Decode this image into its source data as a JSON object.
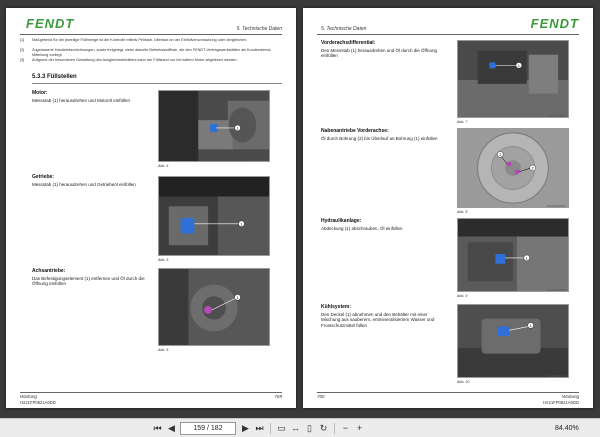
{
  "brand": "FENDT",
  "left_page": {
    "chapter": "5. Technische Daten",
    "footnotes": [
      {
        "num": "[1]",
        "text": "Maßgebend für die jeweilige Füllmenge ist die Kontrolle mittels Peilstab, Überlauf an der Einfüllverschraubung oder dergleichen."
      },
      {
        "num": "[2]",
        "text": "Zugelassene Handelsbezeichnungen, sowie freigelegt, siehe aktuelle Betriebsstoffliste, die den FENDT-Vertragswerkstätten als Kundendienst-Mitteilung vorliegt."
      },
      {
        "num": "[3]",
        "text": "Aufgrund der besonderen Gestaltung des Ausgleichsbehälters kann der Füllstand nur bei kaltem Motor abgelesen werden."
      }
    ],
    "section_title": "5.3.3  Füllstellen",
    "items": [
      {
        "label": "Motor:",
        "text": "Messstab (1) herausdrehen und Motoröl einfüllen",
        "caption": "Abb. 4",
        "code": "FSL0001234567"
      },
      {
        "label": "Getriebe:",
        "text": "Messstab (1) herausdrehen und Getriebeöl einfüllen",
        "caption": "Abb. 5",
        "code": "FSL0001234568"
      },
      {
        "label": "Achsantriebe:",
        "text": "Das Befestigungselement (1) entfernen und Öl durch die Öffnung einfüllen",
        "caption": "Abb. 6",
        "code": "FSL0001234569"
      }
    ],
    "footer_title": "Wartung",
    "footer_code": "H221FP0621A0DD",
    "page_number": "769"
  },
  "right_page": {
    "chapter": "5. Technische Daten",
    "items": [
      {
        "label": "Vorderachsdifferential:",
        "text": "Den Messstab (1) herausdrehen und Öl durch die Öffnung einfüllen",
        "caption": "Abb. 7",
        "code": "FSL0001234570"
      },
      {
        "label": "Nabenantriebe Vorderachse:",
        "text": "Öl durch Bohrung (2) bis Überlauf an Bohrung (1) einfüllen",
        "caption": "Abb. 8",
        "code": "FSL0001234571"
      },
      {
        "label": "Hydraulikanlage:",
        "text": "Abdeckung (1) abschrauben, Öl einfüllen",
        "caption": "Abb. 9",
        "code": "FSL0001234572"
      },
      {
        "label": "Kühlsystem:",
        "text": "Den Deckel (1) abnehmen und den Behälter mit einer Mischung aus sauberem, entmineralisiertem Wasser und Frostschutzmittel füllen",
        "caption": "Abb. 10",
        "code": "FSL0001234573"
      }
    ],
    "footer_page": "700",
    "footer_title": "Wartung",
    "footer_code": "H221FP0621A0DD"
  },
  "toolbar": {
    "page_value": "159 / 182",
    "zoom": "84.40%",
    "icons": [
      "first-page-icon",
      "prev-page-icon",
      "next-page-icon",
      "last-page-icon",
      "fit-page-icon",
      "fit-width-icon",
      "two-page-icon",
      "rotate-icon",
      "zoom-out-icon",
      "zoom-in-icon"
    ]
  },
  "colors": {
    "brand_green": "#3c9a3a",
    "highlight_blue": "#2e6fd8",
    "background": "#3a3a3a"
  }
}
